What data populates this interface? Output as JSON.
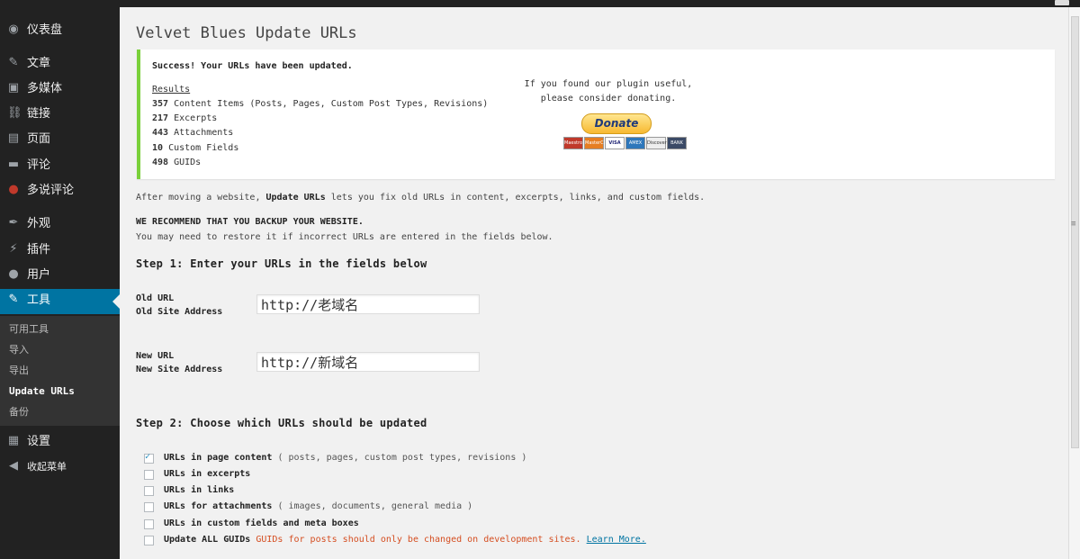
{
  "sidebar": {
    "items": [
      {
        "label": "仪表盘",
        "icon": "dashboard-icon",
        "glyph": "◉"
      },
      {
        "label": "文章",
        "icon": "pin-icon",
        "glyph": "✎"
      },
      {
        "label": "多媒体",
        "icon": "media-icon",
        "glyph": "▣"
      },
      {
        "label": "链接",
        "icon": "link-icon",
        "glyph": "⛓"
      },
      {
        "label": "页面",
        "icon": "page-icon",
        "glyph": "▤"
      },
      {
        "label": "评论",
        "icon": "comment-icon",
        "glyph": "▬"
      },
      {
        "label": "多说评论",
        "icon": "duoshuo-icon",
        "glyph": "●"
      },
      {
        "label": "外观",
        "icon": "appearance-icon",
        "glyph": "✒"
      },
      {
        "label": "插件",
        "icon": "plugin-icon",
        "glyph": "⚡"
      },
      {
        "label": "用户",
        "icon": "user-icon",
        "glyph": "●"
      },
      {
        "label": "工具",
        "icon": "wrench-icon",
        "glyph": "✎"
      },
      {
        "label": "设置",
        "icon": "settings-icon",
        "glyph": "▦"
      },
      {
        "label": "收起菜单",
        "icon": "collapse-icon",
        "glyph": "◀"
      }
    ],
    "submenu": [
      "可用工具",
      "导入",
      "导出",
      "Update URLs",
      "备份"
    ]
  },
  "page": {
    "title": "Velvet Blues Update URLs"
  },
  "notice": {
    "success": "Success! Your URLs have been updated.",
    "results_label": "Results",
    "results": [
      {
        "count": "357",
        "text": "Content Items (Posts, Pages, Custom Post Types, Revisions)"
      },
      {
        "count": "217",
        "text": "Excerpts"
      },
      {
        "count": "443",
        "text": "Attachments"
      },
      {
        "count": "10",
        "text": "Custom Fields"
      },
      {
        "count": "498",
        "text": "GUIDs"
      }
    ],
    "donate_line1": "If you found our plugin useful,",
    "donate_line2": "please consider donating.",
    "donate_button": "Donate",
    "cards": [
      "Maestro",
      "MasterCard",
      "VISA",
      "AMEX",
      "Discover",
      "BANK"
    ]
  },
  "intro": {
    "before": "After moving a website, ",
    "bold": "Update URLs",
    "after": " lets you fix old URLs in content, excerpts, links, and custom fields."
  },
  "warning": {
    "heading": "WE RECOMMEND THAT YOU BACKUP YOUR WEBSITE.",
    "text": "You may need to restore it if incorrect URLs are entered in the fields below."
  },
  "step1": {
    "heading": "Step 1: Enter your URLs in the fields below",
    "old_label1": "Old URL",
    "old_label2": "Old Site Address",
    "old_value": "http://老域名",
    "new_label1": "New URL",
    "new_label2": "New Site Address",
    "new_value": "http://新域名"
  },
  "step2": {
    "heading": "Step 2: Choose which URLs should be updated",
    "options": [
      {
        "label": "URLs in page content",
        "hint": " ( posts, pages, custom post types, revisions )",
        "checked": true
      },
      {
        "label": "URLs in excerpts",
        "hint": "",
        "checked": false
      },
      {
        "label": "URLs in links",
        "hint": "",
        "checked": false
      },
      {
        "label": "URLs for attachments",
        "hint": " ( images, documents, general media )",
        "checked": false
      },
      {
        "label": "URLs in custom fields and meta boxes",
        "hint": "",
        "checked": false
      },
      {
        "label": "Update ALL GUIDs",
        "hint": " GUIDs for posts should only be changed on development sites.",
        "checked": false,
        "link": "Learn More."
      }
    ]
  }
}
